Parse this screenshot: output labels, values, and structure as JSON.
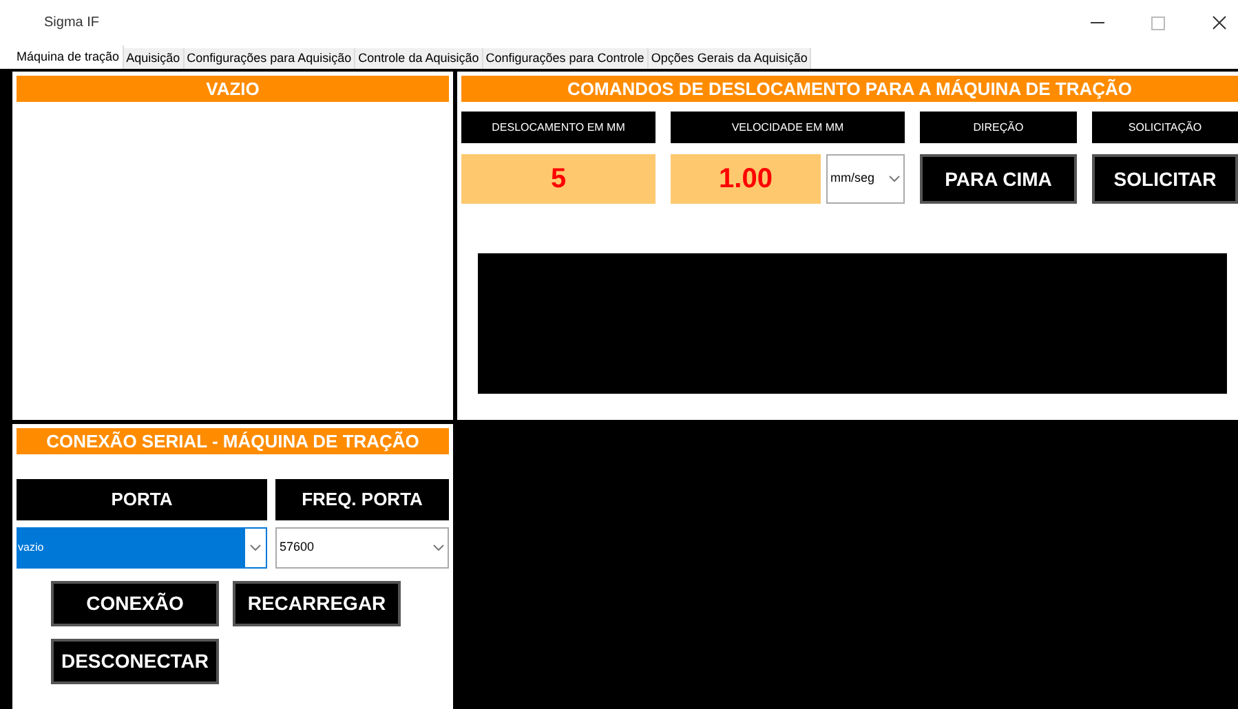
{
  "window": {
    "title": "Sigma IF"
  },
  "tabs": [
    {
      "label": "Máquina de tração",
      "selected": true
    },
    {
      "label": "Aquisição",
      "selected": false
    },
    {
      "label": "Configurações para Aquisição",
      "selected": false
    },
    {
      "label": "Controle da Aquisição",
      "selected": false
    },
    {
      "label": "Configurações para Controle",
      "selected": false
    },
    {
      "label": "Opções Gerais da Aquisição",
      "selected": false
    }
  ],
  "empty_panel": {
    "header": "VAZIO"
  },
  "commands": {
    "header": "COMANDOS DE DESLOCAMENTO PARA A MÁQUINA DE TRAÇÃO",
    "labels": [
      "DESLOCAMENTO EM MM",
      "VELOCIDADE EM MM",
      "DIREÇÃO",
      "SOLICITAÇÃO"
    ],
    "displacement": "5",
    "speed": "1.00",
    "unit": "mm/seg",
    "direction_button": "PARA CIMA",
    "request_button": "SOLICITAR"
  },
  "serial": {
    "header": "CONEXÃO SERIAL - MÁQUINA DE TRAÇÃO",
    "port_label": "PORTA",
    "freq_label": "FREQ. PORTA",
    "port": "vazio",
    "freq": "57600",
    "buttons": [
      "CONEXÃO",
      "RECARREGAR",
      "DESCONECTAR"
    ]
  }
}
